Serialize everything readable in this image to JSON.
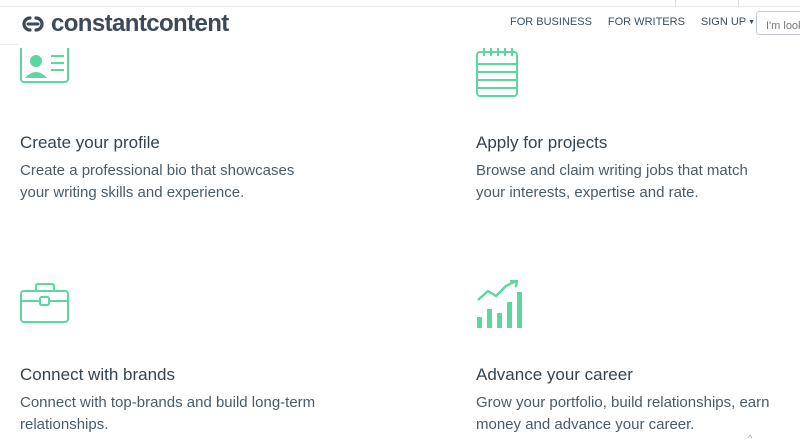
{
  "header": {
    "logo_text": "constantcontent",
    "nav": [
      {
        "label": "FOR BUSINESS"
      },
      {
        "label": "FOR WRITERS"
      },
      {
        "label": "SIGN UP"
      }
    ],
    "search_placeholder": "I'm looking for..."
  },
  "colors": {
    "accent": "#5dd7a0",
    "heading": "#34434f",
    "body": "#4a5b68"
  },
  "features": [
    {
      "icon": "profile-card-icon",
      "title": "Create your profile",
      "description_lines": [
        "Create a professional bio that showcases",
        "your writing skills and experience."
      ]
    },
    {
      "icon": "notepad-icon",
      "title": "Apply for projects",
      "description_lines": [
        "Browse and claim writing jobs that match",
        "your interests, expertise and rate."
      ]
    },
    {
      "icon": "briefcase-icon",
      "title": "Connect with brands",
      "description_lines": [
        "Connect with top-brands and build long-term",
        "relationships."
      ]
    },
    {
      "icon": "growth-chart-icon",
      "title": "Advance your career",
      "description_lines": [
        "Grow your portfolio, build relationships, earn",
        "money and advance your career."
      ]
    }
  ],
  "scroll_hint": "^"
}
